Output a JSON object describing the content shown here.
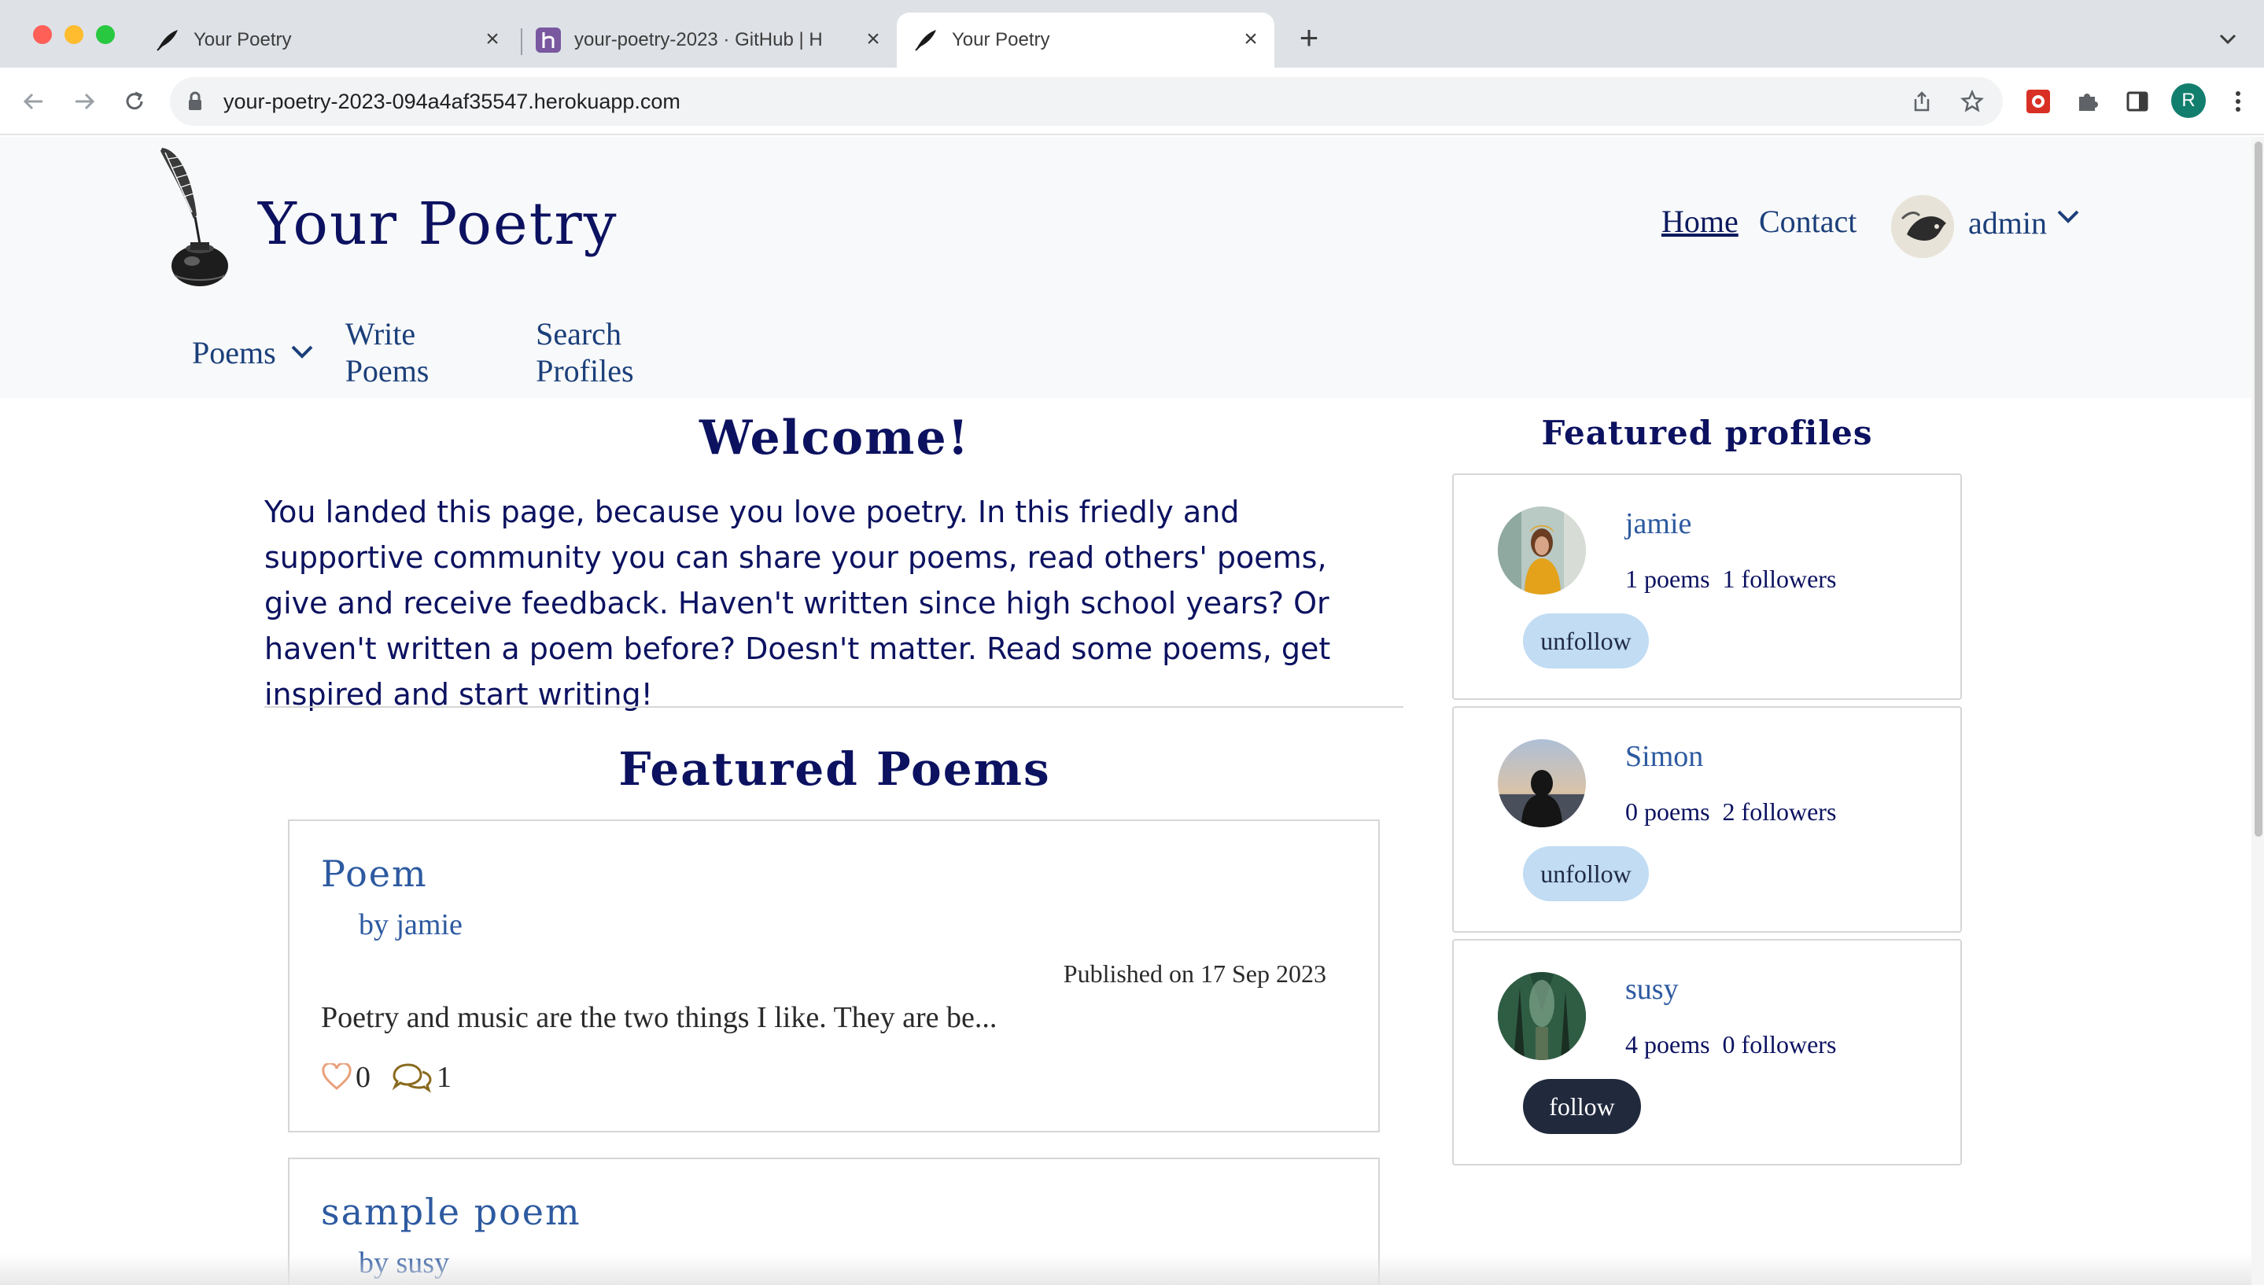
{
  "browser": {
    "tabs": [
      {
        "title": "Your Poetry",
        "icon": "feather-icon",
        "active": false
      },
      {
        "title": "your-poetry-2023 · GitHub | H",
        "icon": "heroku-icon",
        "active": false
      },
      {
        "title": "Your Poetry",
        "icon": "feather-icon",
        "active": true
      }
    ],
    "url": "your-poetry-2023-094a4af35547.herokuapp.com",
    "profile_initial": "R"
  },
  "site": {
    "title": "Your Poetry",
    "nav": {
      "home": "Home",
      "contact": "Contact",
      "user": "admin"
    },
    "subnav": {
      "poems": "Poems",
      "write": "Write Poems",
      "search": "Search Profiles"
    }
  },
  "welcome": {
    "title": "Welcome!",
    "text": "You landed this page, because you love poetry. In this friedly and supportive community you can share your poems, read others' poems, give and receive feedback. Haven't written since high school years? Or haven't written a poem before? Doesn't matter. Read some poems, get inspired and start writing!"
  },
  "featured_poems": {
    "title": "Featured Poems",
    "poems": [
      {
        "title": "Poem",
        "author": "by jamie",
        "date": "Published on 17 Sep 2023",
        "excerpt": "Poetry and music are the two things I like. They are be...",
        "likes": "0",
        "comments": "1"
      },
      {
        "title": "sample poem",
        "author": "by susy"
      }
    ]
  },
  "featured_profiles": {
    "title": "Featured profiles",
    "profiles": [
      {
        "name": "jamie",
        "poems": "1 poems",
        "followers": "1 followers",
        "button": "unfollow"
      },
      {
        "name": "Simon",
        "poems": "0 poems",
        "followers": "2 followers",
        "button": "unfollow"
      },
      {
        "name": "susy",
        "poems": "4 poems",
        "followers": "0 followers",
        "button": "follow"
      }
    ]
  },
  "colors": {
    "brand": "#0c1260",
    "link": "#2d5aa0",
    "unfollow_bg": "#c1dcf3",
    "follow_bg": "#212a3d",
    "like_icon": "#e8a07a",
    "comment_icon": "#8a6a1e"
  }
}
